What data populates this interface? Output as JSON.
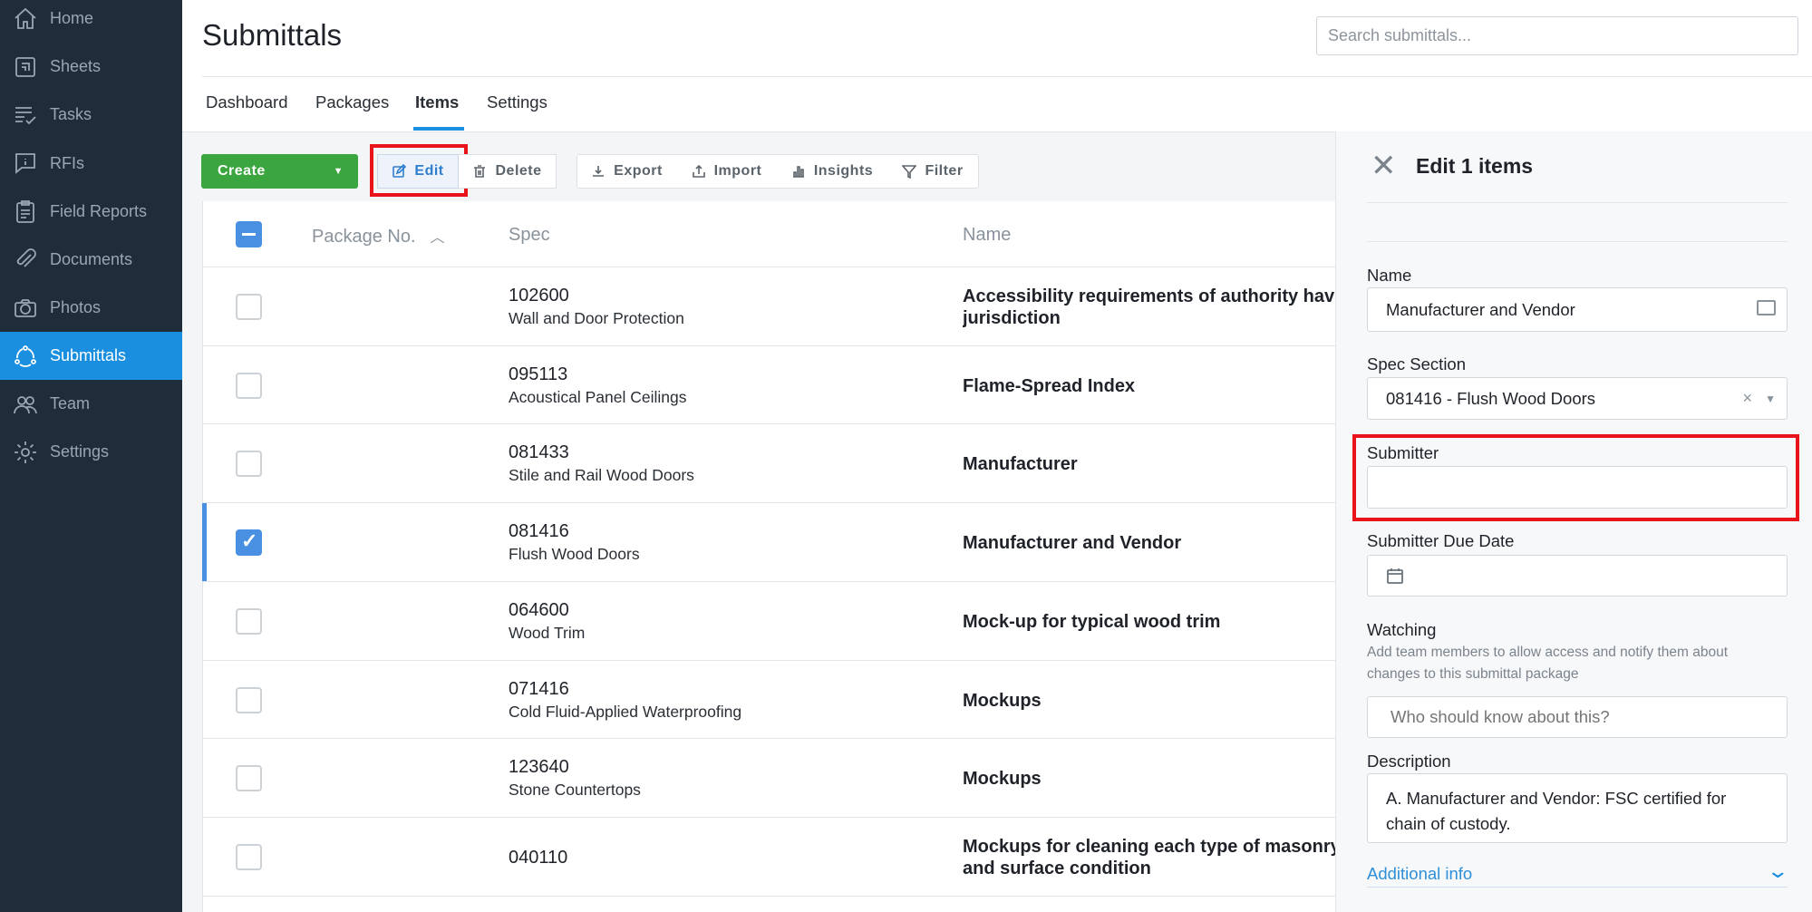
{
  "sidebar": {
    "items": [
      {
        "label": "Home",
        "icon": "home-icon"
      },
      {
        "label": "Sheets",
        "icon": "sheets-icon"
      },
      {
        "label": "Tasks",
        "icon": "tasks-icon"
      },
      {
        "label": "RFIs",
        "icon": "rfi-icon"
      },
      {
        "label": "Field Reports",
        "icon": "clipboard-icon"
      },
      {
        "label": "Documents",
        "icon": "paperclip-icon"
      },
      {
        "label": "Photos",
        "icon": "camera-icon"
      },
      {
        "label": "Submittals",
        "icon": "submittals-icon",
        "active": true
      },
      {
        "label": "Team",
        "icon": "team-icon"
      },
      {
        "label": "Settings",
        "icon": "gear-icon"
      }
    ]
  },
  "header": {
    "title": "Submittals",
    "search_placeholder": "Search submittals..."
  },
  "tabs": [
    {
      "label": "Dashboard"
    },
    {
      "label": "Packages"
    },
    {
      "label": "Items",
      "active": true
    },
    {
      "label": "Settings"
    }
  ],
  "toolbar": {
    "create": "Create",
    "edit": "Edit",
    "delete": "Delete",
    "export": "Export",
    "import": "Import",
    "insights": "Insights",
    "filter": "Filter"
  },
  "table": {
    "columns": [
      "Package No.",
      "Spec",
      "Name"
    ],
    "rows": [
      {
        "code": "102600",
        "spec": "Wall and Door Protection",
        "name": [
          "Accessibility requirements of authority having",
          "jurisdiction"
        ],
        "checked": false
      },
      {
        "code": "095113",
        "spec": "Acoustical Panel Ceilings",
        "name": [
          "Flame-Spread Index"
        ],
        "checked": false
      },
      {
        "code": "081433",
        "spec": "Stile and Rail Wood Doors",
        "name": [
          "Manufacturer"
        ],
        "checked": false
      },
      {
        "code": "081416",
        "spec": "Flush Wood Doors",
        "name": [
          "Manufacturer and Vendor"
        ],
        "checked": true
      },
      {
        "code": "064600",
        "spec": "Wood Trim",
        "name": [
          "Mock-up for typical wood trim"
        ],
        "checked": false
      },
      {
        "code": "071416",
        "spec": "Cold Fluid-Applied Waterproofing",
        "name": [
          "Mockups"
        ],
        "checked": false
      },
      {
        "code": "123640",
        "spec": "Stone Countertops",
        "name": [
          "Mockups"
        ],
        "checked": false
      },
      {
        "code": "040110",
        "spec": "",
        "name": [
          "Mockups for cleaning each type of masonry",
          "and surface condition"
        ],
        "checked": false
      }
    ]
  },
  "panel": {
    "title": "Edit 1 items",
    "name_label": "Name",
    "name_value": "Manufacturer and Vendor",
    "spec_label": "Spec Section",
    "spec_value": "081416 - Flush Wood Doors",
    "submitter_label": "Submitter",
    "submitter_value": "",
    "due_label": "Submitter Due Date",
    "watching_label": "Watching",
    "watching_help_1": "Add team members to allow access and notify them about",
    "watching_help_2": "changes to this submittal package",
    "watching_placeholder": "Who should know about this?",
    "description_label": "Description",
    "description_1": "A. Manufacturer and Vendor: FSC certified for",
    "description_2": "chain of custody.",
    "additional_info": "Additional info"
  },
  "colors": {
    "sidebar": "#1f2d3a",
    "accent": "#1a8fe0",
    "create": "#3ba63f",
    "highlight": "#e8141a"
  }
}
